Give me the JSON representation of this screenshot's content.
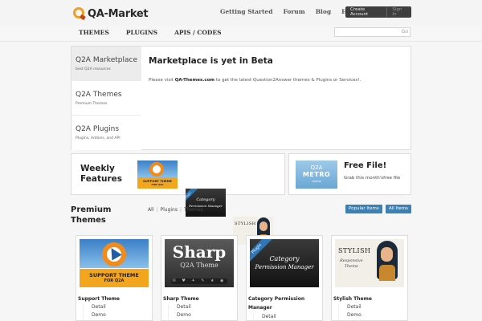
{
  "header": {
    "logo_text": "QA-Market",
    "nav": [
      "Getting Started",
      "Forum",
      "Blog",
      "Help"
    ],
    "create_account": "Create Account",
    "sign_in": "Sign In"
  },
  "mainnav": {
    "items": [
      "THEMES",
      "PLUGINS",
      "APIS / CODES"
    ],
    "search_placeholder": "",
    "search_go": "Go"
  },
  "sidebar": {
    "items": [
      {
        "title": "Q2A Marketplace",
        "subtitle": "best Q2A resources"
      },
      {
        "title": "Q2A Themes",
        "subtitle": "Premium Themes"
      },
      {
        "title": "Q2A Plugins",
        "subtitle": "Plugins, Addons, and API"
      }
    ]
  },
  "hero": {
    "title": "Marketplace is yet in Beta",
    "text_before": "Please visit ",
    "link": "QA-Themes.com",
    "text_after": " to get the latest Question2Answer themes & Plugins or Services!."
  },
  "weekly": {
    "title_line1": "Weekly",
    "title_line2": "Features"
  },
  "freefile": {
    "title": "Free File!",
    "subtitle": "Grab this month'sfree file",
    "thumb_line1": "Q2A",
    "thumb_line2": "METRO",
    "thumb_line3": "theme"
  },
  "premium": {
    "title_line1": "Premium",
    "title_line2": "Themes",
    "filters": [
      "All",
      "Plugins",
      "Themes"
    ],
    "popular_button": "Popular Items",
    "all_button": "All Items",
    "cards": [
      {
        "name": "Support Theme",
        "detail": "Detail",
        "demo": "Demo"
      },
      {
        "name": "Sharp Theme",
        "detail": "Detail",
        "demo": "Demo"
      },
      {
        "name": "Category Permission Manager",
        "detail": "Detail",
        "demo": ""
      },
      {
        "name": "Stylish Theme",
        "detail": "Detail",
        "demo": "Demo"
      }
    ]
  },
  "art": {
    "support_l1": "SUPPORT THEME",
    "support_l2": "FOR Q2A",
    "sharp_big": "Sharp",
    "sharp_sub": "Q2A Theme",
    "perm_ribbon": "Plugin",
    "perm_l1": "Category",
    "perm_l2": "Permission Manager",
    "stylish_title": "STYLISH",
    "stylish_l1": "Responsive",
    "stylish_l2": "Theme"
  }
}
